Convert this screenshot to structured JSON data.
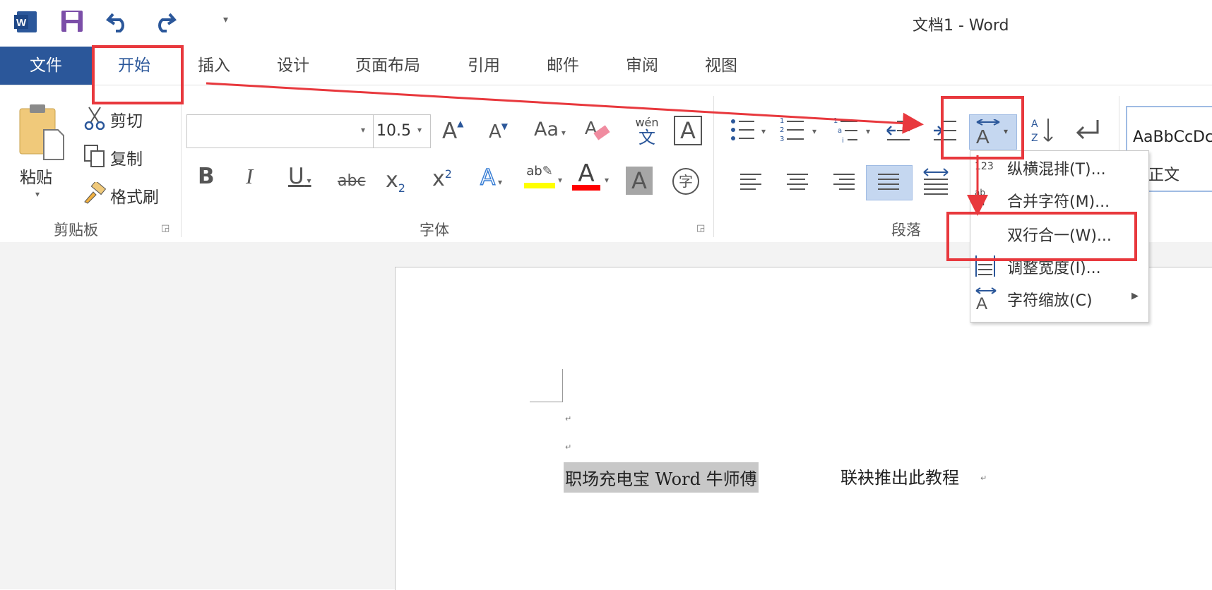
{
  "window": {
    "title": "文档1 - Word"
  },
  "qat": {
    "customize_arrow": "▾"
  },
  "tabs": {
    "file": "文件",
    "home": "开始",
    "insert": "插入",
    "design": "设计",
    "layout": "页面布局",
    "references": "引用",
    "mailings": "邮件",
    "review": "审阅",
    "view": "视图"
  },
  "clipboard": {
    "paste": "粘贴",
    "cut": "剪切",
    "copy": "复制",
    "format_painter": "格式刷",
    "group_label": "剪贴板"
  },
  "font": {
    "font_name": "",
    "font_size": "10.5",
    "group_label": "字体",
    "change_case": "Aa",
    "phonetic_top": "wén",
    "phonetic_bottom": "文",
    "bold": "B",
    "italic": "I",
    "underline": "U",
    "strike": "abc",
    "subscript": "x",
    "sub2": "2",
    "superscript": "x",
    "sup2": "2",
    "enclose": "字"
  },
  "paragraph": {
    "group_label": "段落"
  },
  "styles": {
    "preview": "AaBbCcDc",
    "normal": "正文"
  },
  "asian_layout_menu": {
    "items": [
      {
        "label": "纵横混排(T)...",
        "icon": "123"
      },
      {
        "label": "合并字符(M)...",
        "icon": "ab cd"
      },
      {
        "label": "双行合一(W)...",
        "icon": ""
      },
      {
        "label": "调整宽度(I)...",
        "icon": "width-icon"
      },
      {
        "label": "字符缩放(C)",
        "icon": "scale-icon"
      }
    ]
  },
  "document": {
    "selected_text": "职场充电宝 Word 牛师傅",
    "rest_text": "联袂推出此教程",
    "para_mark": "↵"
  },
  "colors": {
    "file_tab": "#2b579a",
    "annotation": "#e8383d",
    "highlight": "#ffff00",
    "font_color": "#ff0000",
    "word_blue": "#2b579a"
  }
}
